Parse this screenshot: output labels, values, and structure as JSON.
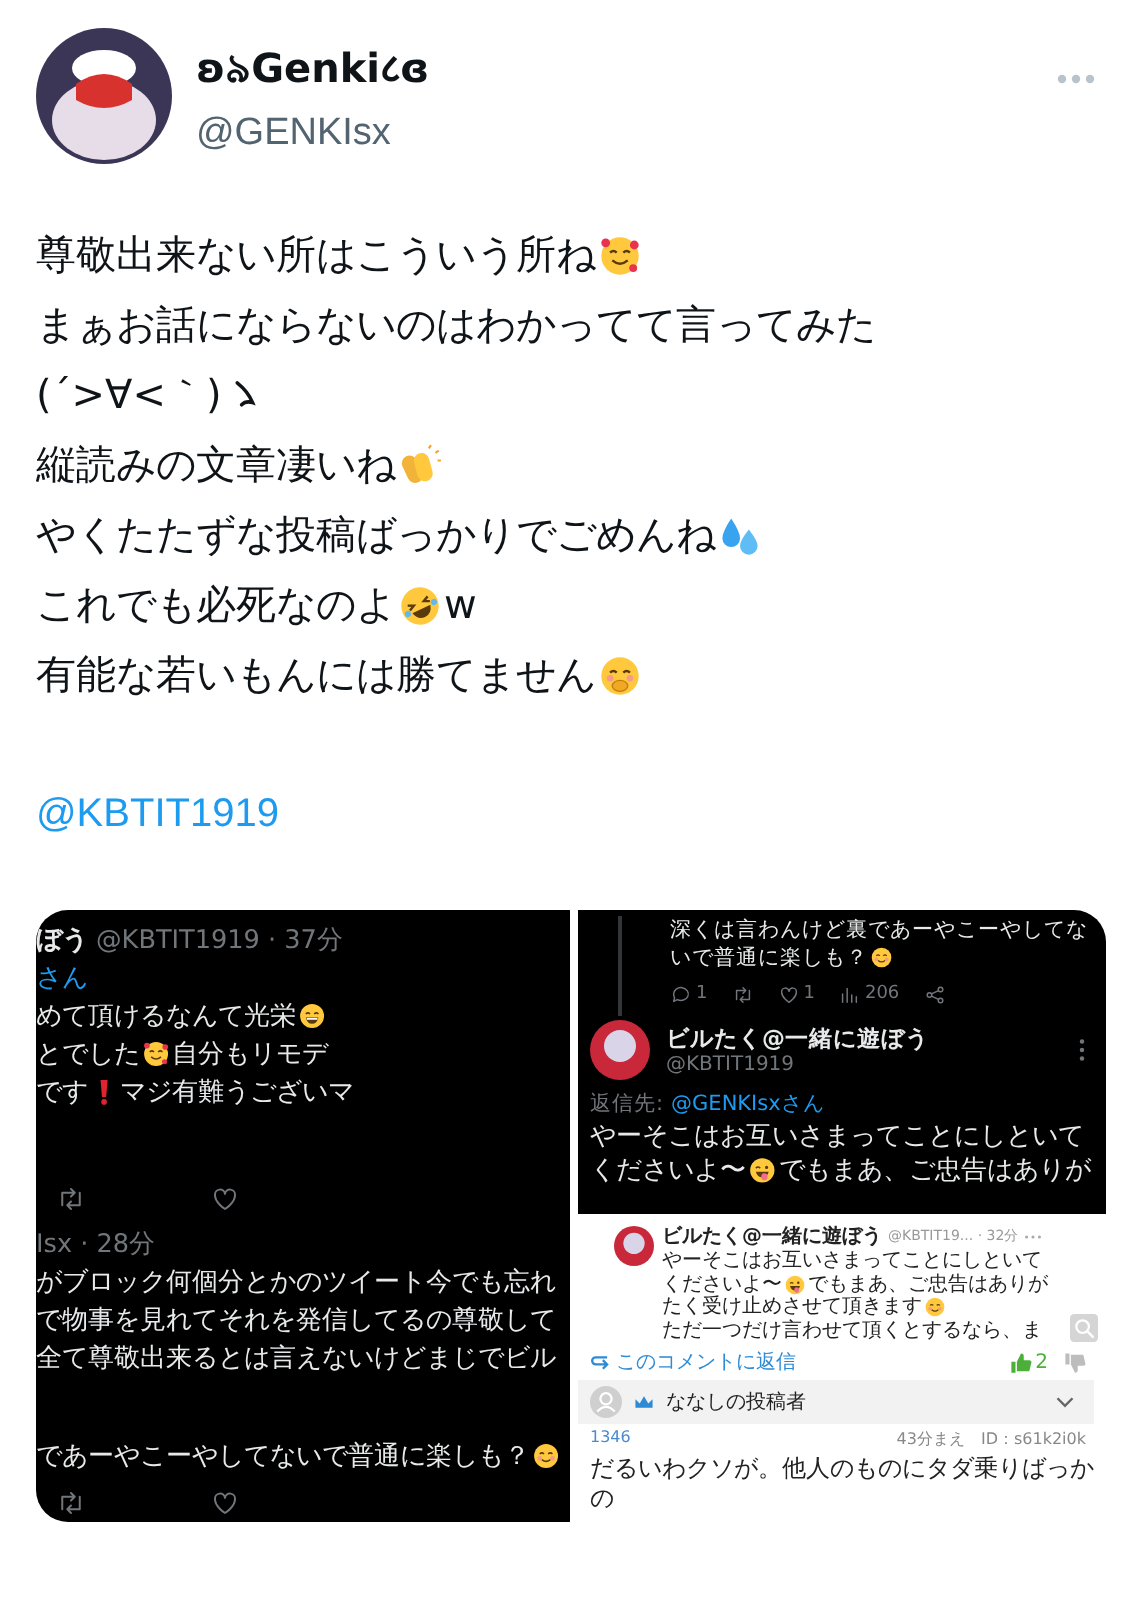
{
  "author": {
    "name": "ʚ৯Genki८ɞ",
    "handle": "@GENKIsx"
  },
  "tweet": {
    "lines": [
      [
        {
          "kind": "plain",
          "text": "尊敬出来ない所はこういう所ね"
        },
        {
          "kind": "hearts-face"
        }
      ],
      [
        {
          "kind": "plain",
          "text": "まぁお話にならないのはわかってて言ってみた"
        }
      ],
      [
        {
          "kind": "plain",
          "text": "(´>∀<｀)"
        },
        {
          "kind": "salute-mark"
        }
      ],
      [
        {
          "kind": "plain",
          "text": "縦読みの文章凄いね"
        },
        {
          "kind": "clap"
        }
      ],
      [
        {
          "kind": "plain",
          "text": "やくたたずな投稿ばっかりでごめんね"
        },
        {
          "kind": "droplets"
        }
      ],
      [
        {
          "kind": "plain",
          "text": "これでも必死なのよ"
        },
        {
          "kind": "rofl-face"
        },
        {
          "kind": "plain",
          "text": "w"
        }
      ],
      [
        {
          "kind": "plain",
          "text": "有能な若いもんには勝てません"
        },
        {
          "kind": "shush-face"
        }
      ]
    ],
    "mention": "@KBTIT1919"
  },
  "media": {
    "left": [
      {
        "kind": "text",
        "segs": [
          {
            "kind": "strong",
            "text": "ぼう"
          },
          {
            "kind": "muted",
            "text": "@KBTIT1919 · 37分"
          }
        ]
      },
      {
        "kind": "text",
        "segs": [
          {
            "kind": "link",
            "text": "さん"
          }
        ]
      },
      {
        "kind": "text",
        "segs": [
          {
            "kind": "plain",
            "text": "めて頂けるなんて光栄"
          },
          {
            "kind": "grin-face"
          }
        ]
      },
      {
        "kind": "text",
        "segs": [
          {
            "kind": "plain",
            "text": "とでした"
          },
          {
            "kind": "hearts-face"
          },
          {
            "kind": "plain",
            "text": "自分もリモデ"
          }
        ]
      },
      {
        "kind": "text",
        "segs": [
          {
            "kind": "plain",
            "text": "です"
          },
          {
            "kind": "exclamation"
          },
          {
            "kind": "plain",
            "text": "マジ有難うございマ"
          }
        ]
      },
      {
        "kind": "gap"
      },
      {
        "kind": "actions",
        "items": [
          {
            "kind": "retweet"
          },
          {
            "kind": "like"
          }
        ]
      },
      {
        "kind": "text",
        "segs": [
          {
            "kind": "muted",
            "text": "Isx · 28分"
          }
        ]
      },
      {
        "kind": "text",
        "segs": [
          {
            "kind": "plain",
            "text": "がブロック何個分とかのツイート今でも忘れ"
          }
        ]
      },
      {
        "kind": "text",
        "segs": [
          {
            "kind": "plain",
            "text": "で物事を見れてそれを発信してるの尊敬して"
          }
        ]
      },
      {
        "kind": "text",
        "segs": [
          {
            "kind": "plain",
            "text": "全て尊敬出来るとは言えないけどまじでビル"
          }
        ]
      },
      {
        "kind": "gap"
      },
      {
        "kind": "text",
        "segs": [
          {
            "kind": "plain",
            "text": "であーやこーやしてないで普通に楽しも？"
          },
          {
            "kind": "blush-face"
          }
        ]
      },
      {
        "kind": "actions",
        "items": [
          {
            "kind": "retweet"
          },
          {
            "kind": "like"
          }
        ]
      }
    ],
    "right_top": [
      {
        "kind": "thread-text",
        "segs": [
          {
            "kind": "plain",
            "text": "深くは言わんけど裏であーやこーやしてな"
          }
        ]
      },
      {
        "kind": "thread-text",
        "segs": [
          {
            "kind": "plain",
            "text": "いで普通に楽しも？"
          },
          {
            "kind": "blush-face"
          }
        ]
      },
      {
        "kind": "thread-actions",
        "items": [
          {
            "kind": "reply",
            "count": "1"
          },
          {
            "kind": "retweet"
          },
          {
            "kind": "like",
            "count": "1"
          },
          {
            "kind": "views",
            "count": "206"
          },
          {
            "kind": "share"
          }
        ]
      },
      {
        "kind": "author",
        "name": "ビルたく@一緒に遊ぼう",
        "handle": "@KBTIT1919"
      },
      {
        "kind": "small-text",
        "segs": [
          {
            "kind": "muted",
            "text": "返信先:"
          },
          {
            "kind": "link",
            "text": "@GENKIsxさん"
          }
        ]
      },
      {
        "kind": "big-text",
        "segs": [
          {
            "kind": "plain",
            "text": "やーそこはお互いさまってことにしといて"
          }
        ]
      },
      {
        "kind": "big-text",
        "segs": [
          {
            "kind": "plain",
            "text": "くださいよ〜"
          },
          {
            "kind": "tongue-face"
          },
          {
            "kind": "plain",
            "text": "でもまあ、ご忠告はありが"
          }
        ]
      }
    ],
    "comment": {
      "quote": {
        "name": "ビルたく@一緒に遊ぼう",
        "meta": "@KBTIT19... · 32分",
        "lines": [
          [
            {
              "kind": "plain",
              "text": "やーそこはお互いさまってことにしといて"
            }
          ],
          [
            {
              "kind": "plain",
              "text": "くださいよ〜"
            },
            {
              "kind": "tongue-face"
            },
            {
              "kind": "plain",
              "text": "でもまあ、ご忠告はありが"
            }
          ],
          [
            {
              "kind": "plain",
              "text": "たく受け止めさせて頂きます"
            },
            {
              "kind": "blush-face"
            }
          ],
          [
            {
              "kind": "plain",
              "text": "ただ一つだけ言わせて頂くとするなら、ま"
            }
          ]
        ]
      },
      "reply_link": "このコメントに返信",
      "likes": "2",
      "poster": "ななしの投稿者",
      "number": "1346",
      "meta": "43分まえ　ID：s61k2i0k",
      "text": "だるいわクソが。他人のものにタダ乗りばっかの"
    }
  }
}
